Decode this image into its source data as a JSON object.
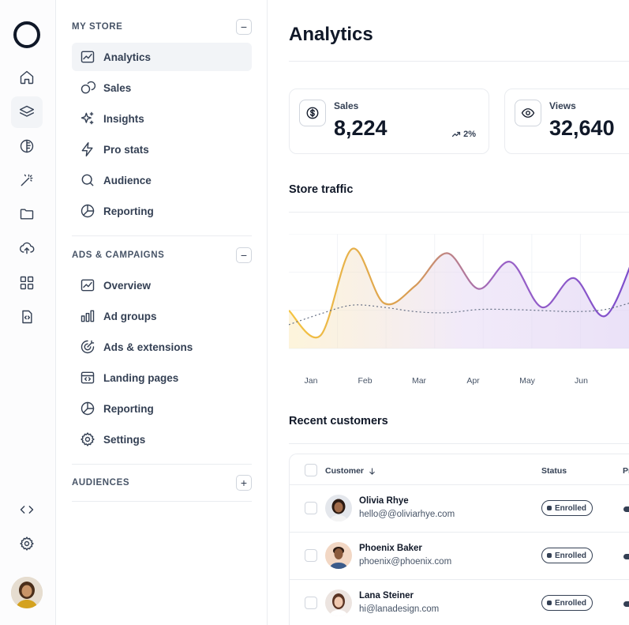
{
  "rail": {
    "icons": [
      "logo-circle",
      "home-icon",
      "layers-icon",
      "contrast-icon",
      "magic-wand-icon",
      "folder-icon",
      "upload-cloud-icon",
      "grid-icon",
      "file-code-icon",
      "code-icon",
      "settings-icon"
    ]
  },
  "sidebar": {
    "my_store": {
      "title": "MY STORE",
      "toggle": "−",
      "items": [
        {
          "label": "Analytics",
          "icon": "chart-icon"
        },
        {
          "label": "Sales",
          "icon": "coins-icon"
        },
        {
          "label": "Insights",
          "icon": "sparkles-icon"
        },
        {
          "label": "Pro stats",
          "icon": "lightning-icon"
        },
        {
          "label": "Audience",
          "icon": "search-icon"
        },
        {
          "label": "Reporting",
          "icon": "pie-chart-icon"
        }
      ]
    },
    "ads": {
      "title": "ADS & CAMPAIGNS",
      "toggle": "−",
      "items": [
        {
          "label": "Overview",
          "icon": "chart-icon"
        },
        {
          "label": "Ad groups",
          "icon": "bar-chart-icon"
        },
        {
          "label": "Ads & extensions",
          "icon": "target-icon"
        },
        {
          "label": "Landing pages",
          "icon": "browser-code-icon"
        },
        {
          "label": "Reporting",
          "icon": "pie-chart-icon"
        },
        {
          "label": "Settings",
          "icon": "gear-icon"
        }
      ]
    },
    "audiences": {
      "title": "AUDIENCES",
      "toggle": "+"
    }
  },
  "main": {
    "title": "Analytics",
    "stats": [
      {
        "label": "Sales",
        "value": "8,224",
        "trend": "2%",
        "icon": "dollar-icon"
      },
      {
        "label": "Views",
        "value": "32,640",
        "icon": "eye-icon"
      }
    ],
    "traffic_title": "Store traffic",
    "customers_title": "Recent customers",
    "table": {
      "headers": {
        "customer": "Customer",
        "status": "Status",
        "extra": "Pr"
      },
      "rows": [
        {
          "name": "Olivia Rhye",
          "email": "hello@@oliviarhye.com",
          "status": "Enrolled"
        },
        {
          "name": "Phoenix Baker",
          "email": "phoenix@phoenix.com",
          "status": "Enrolled"
        },
        {
          "name": "Lana Steiner",
          "email": "hi@lanadesign.com",
          "status": "Enrolled"
        }
      ]
    }
  },
  "chart_data": {
    "type": "area",
    "categories": [
      "Jan",
      "Feb",
      "Mar",
      "Apr",
      "May",
      "Jun"
    ],
    "grid": true,
    "series": [
      {
        "values": [
          0.35,
          0.12,
          0.92,
          0.42,
          0.58,
          0.88,
          0.55,
          0.8,
          0.38,
          0.65,
          0.3,
          0.92
        ]
      },
      {
        "values": [
          0.22,
          0.32,
          0.4,
          0.38,
          0.34,
          0.33,
          0.36,
          0.36,
          0.35,
          0.34,
          0.36,
          0.44
        ]
      }
    ],
    "colors": {
      "start": "#f5c542",
      "end": "#7c4dcc",
      "baseline": "#667085"
    }
  }
}
